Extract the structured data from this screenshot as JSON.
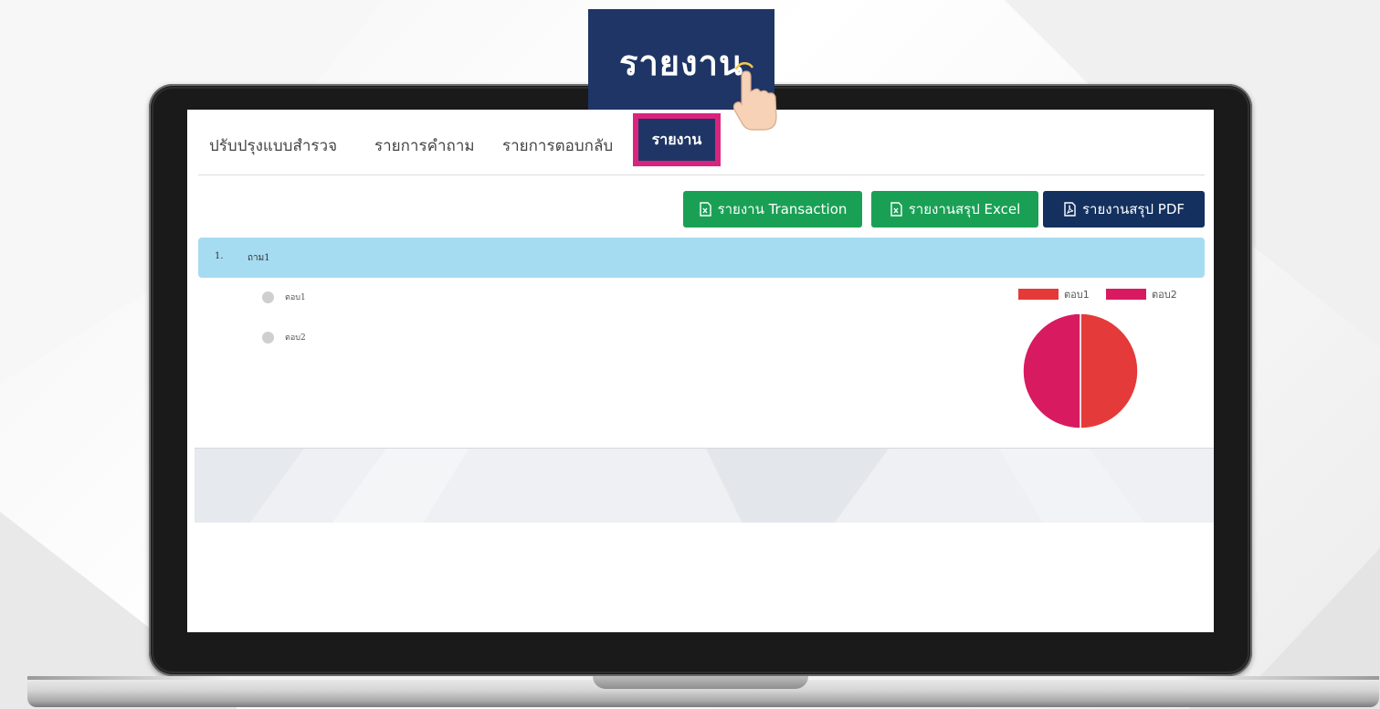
{
  "callout": {
    "label": "รายงาน"
  },
  "nav": {
    "tabs": [
      {
        "label": "ปรับปรุงแบบสำรวจ"
      },
      {
        "label": "รายการคำถาม"
      },
      {
        "label": "รายการตอบกลับ"
      }
    ],
    "active_tab": {
      "label": "รายงาน"
    }
  },
  "toolbar": {
    "transaction_button": "รายงาน Transaction",
    "excel_button": "รายงานสรุป Excel",
    "pdf_button": "รายงานสรุป PDF"
  },
  "question": {
    "number": "1.",
    "text": "ถาม1",
    "options": [
      {
        "label": "ตอบ1"
      },
      {
        "label": "ตอบ2"
      }
    ]
  },
  "colors": {
    "callout_bg": "#1f3565",
    "active_tab_border": "#d9247e",
    "green_button": "#1aa055",
    "navy_button": "#13305e",
    "question_bar": "#a6dcf2"
  },
  "chart_data": {
    "type": "pie",
    "categories": [
      "ตอบ1",
      "ตอบ2"
    ],
    "values": [
      50,
      50
    ],
    "colors": [
      "#e53a3a",
      "#d81b60"
    ],
    "legend": "top"
  }
}
